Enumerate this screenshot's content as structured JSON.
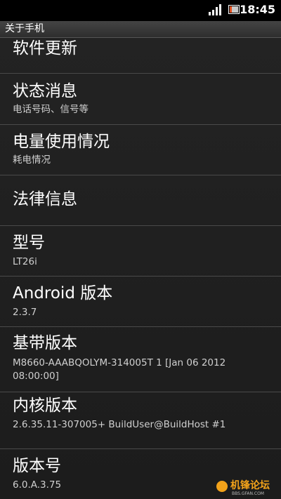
{
  "status_bar": {
    "time": "18:45",
    "icons": [
      "signal-icon",
      "battery-icon"
    ]
  },
  "title_bar": {
    "title": "关于手机"
  },
  "items": [
    {
      "label": "软件更新"
    },
    {
      "label": "状态消息",
      "sub": "电话号码、信号等"
    },
    {
      "label": "电量使用情况",
      "sub": "耗电情况"
    },
    {
      "label": "法律信息"
    },
    {
      "label": "型号",
      "sub": "LT26i"
    },
    {
      "label": "Android 版本",
      "sub": "2.3.7"
    },
    {
      "label": "基带版本",
      "sub": "M8660-AAABQOLYM-314005T 1 [Jan 06 2012 08:00:00]"
    },
    {
      "label": "内核版本",
      "sub": "2.6.35.11-307005+ BuildUser@BuildHost #1"
    },
    {
      "label": "版本号",
      "sub": "6.0.A.3.75"
    }
  ],
  "watermark": {
    "text": "机锋论坛",
    "sub": "BBS.GFAN.COM"
  },
  "colors": {
    "background": "#1f1f1f",
    "status_bar": "#000000",
    "divider": "#4a4a4a",
    "text_primary": "#ffffff",
    "text_secondary": "#d0d0d0",
    "watermark_accent": "#f2a21a"
  }
}
